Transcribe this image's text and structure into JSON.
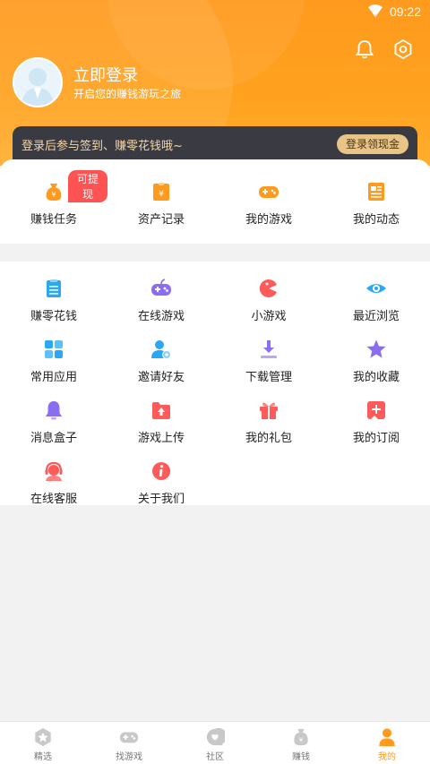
{
  "status_bar": {
    "time": "09:22"
  },
  "header": {
    "login_title": "立即登录",
    "login_subtitle": "开启您的赚钱游玩之旅",
    "icons": [
      "bell-icon",
      "settings-icon"
    ]
  },
  "banner": {
    "text": "登录后参与签到、赚零花钱哦~",
    "button_label": "登录领现金"
  },
  "quick_actions": [
    {
      "label": "赚钱任务",
      "icon": "money-bag-icon",
      "badge": "可提现",
      "color": "#ff9a1e"
    },
    {
      "label": "资产记录",
      "icon": "asset-record-icon",
      "color": "#ff9a1e"
    },
    {
      "label": "我的游戏",
      "icon": "gamepad-icon",
      "color": "#ff9a1e"
    },
    {
      "label": "我的动态",
      "icon": "news-icon",
      "color": "#ff9a1e"
    }
  ],
  "menu_items": [
    {
      "label": "赚零花钱",
      "icon": "clipboard-list-icon",
      "color": "#29a8f5"
    },
    {
      "label": "在线游戏",
      "icon": "online-game-icon",
      "color": "#8a6df0"
    },
    {
      "label": "小游戏",
      "icon": "pacman-icon",
      "color": "#ff5a5a"
    },
    {
      "label": "最近浏览",
      "icon": "eye-icon",
      "color": "#29a8f5"
    },
    {
      "label": "常用应用",
      "icon": "apps-grid-icon",
      "color": "#29a8f5"
    },
    {
      "label": "邀请好友",
      "icon": "invite-user-icon",
      "color": "#29a8f5"
    },
    {
      "label": "下载管理",
      "icon": "download-icon",
      "color": "#8a6df0"
    },
    {
      "label": "我的收藏",
      "icon": "star-icon",
      "color": "#8a6df0"
    },
    {
      "label": "消息盒子",
      "icon": "bell-message-icon",
      "color": "#8a6df0"
    },
    {
      "label": "游戏上传",
      "icon": "folder-upload-icon",
      "color": "#ff5a5a"
    },
    {
      "label": "我的礼包",
      "icon": "gift-icon",
      "color": "#ff5a5a"
    },
    {
      "label": "我的订阅",
      "icon": "subscribe-icon",
      "color": "#ff5a5a"
    },
    {
      "label": "在线客服",
      "icon": "customer-service-icon",
      "color": "#ff5a5a"
    },
    {
      "label": "关于我们",
      "icon": "info-icon",
      "color": "#ff5a5a"
    }
  ],
  "tab_bar": [
    {
      "label": "精选",
      "icon": "star-tab-icon"
    },
    {
      "label": "找游戏",
      "icon": "gamepad-tab-icon"
    },
    {
      "label": "社区",
      "icon": "chat-tab-icon"
    },
    {
      "label": "赚钱",
      "icon": "money-tab-icon"
    },
    {
      "label": "我的",
      "icon": "person-tab-icon",
      "active": true
    }
  ],
  "colors": {
    "accent": "#ff9a1e",
    "banner_bg": "#3a3a42",
    "banner_button": "#e8c487"
  }
}
